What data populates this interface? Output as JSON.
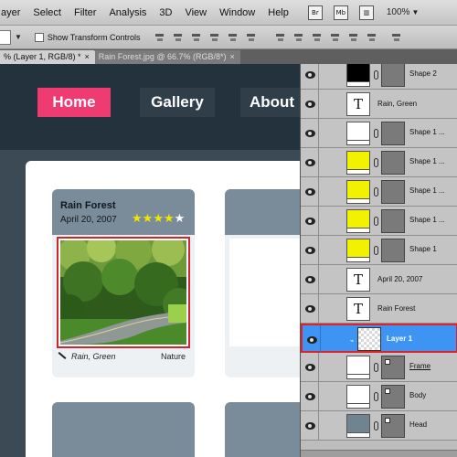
{
  "menubar": {
    "items": [
      "ayer",
      "Select",
      "Filter",
      "Analysis",
      "3D",
      "View",
      "Window",
      "Help"
    ],
    "zoom": "100%",
    "icons": [
      "bridge-icon",
      "mini-bridge-icon",
      "arrange-icon"
    ],
    "icon_glyphs": [
      "Br",
      "Mb",
      "▥"
    ]
  },
  "options": {
    "show_transform_label": "Show Transform Controls",
    "show_transform_checked": false
  },
  "tabs": [
    {
      "label": "% (Layer 1, RGB/8) *",
      "close": "×"
    },
    {
      "label": "Rain Forest.jpg @ 66.7% (RGB/8*)",
      "close": "×"
    }
  ],
  "site": {
    "nav": {
      "home": "Home",
      "gallery": "Gallery",
      "about": "About"
    },
    "colors": {
      "header_bg": "#24323d",
      "home_bg": "#ee3c73",
      "card_head": "#7a8c99",
      "frame": "#d2242e"
    },
    "card": {
      "title": "Rain Forest",
      "date": "April 20, 2007",
      "rating": 4,
      "rating_max": 5,
      "caption": "Rain, Green",
      "category": "Nature"
    }
  },
  "layers": [
    {
      "type": "shape",
      "name": "Shape 2",
      "color": "#000000"
    },
    {
      "type": "text",
      "name": "Rain, Green"
    },
    {
      "type": "shape",
      "name": "Shape 1 ...",
      "color": "#ffffff"
    },
    {
      "type": "shape",
      "name": "Shape 1 ...",
      "color": "#f2f200"
    },
    {
      "type": "shape",
      "name": "Shape 1 ...",
      "color": "#f2f200"
    },
    {
      "type": "shape",
      "name": "Shape 1 ...",
      "color": "#f2f200"
    },
    {
      "type": "shape",
      "name": "Shape 1",
      "color": "#f2f200"
    },
    {
      "type": "text",
      "name": "April 20, 2007"
    },
    {
      "type": "text",
      "name": "Rain Forest"
    },
    {
      "type": "raster",
      "name": "Layer 1",
      "selected": true
    },
    {
      "type": "masked",
      "name": "Frame",
      "color": "#ffffff"
    },
    {
      "type": "masked",
      "name": "Body",
      "color": "#ffffff"
    },
    {
      "type": "masked",
      "name": "Head",
      "color": "#6f8391"
    }
  ]
}
